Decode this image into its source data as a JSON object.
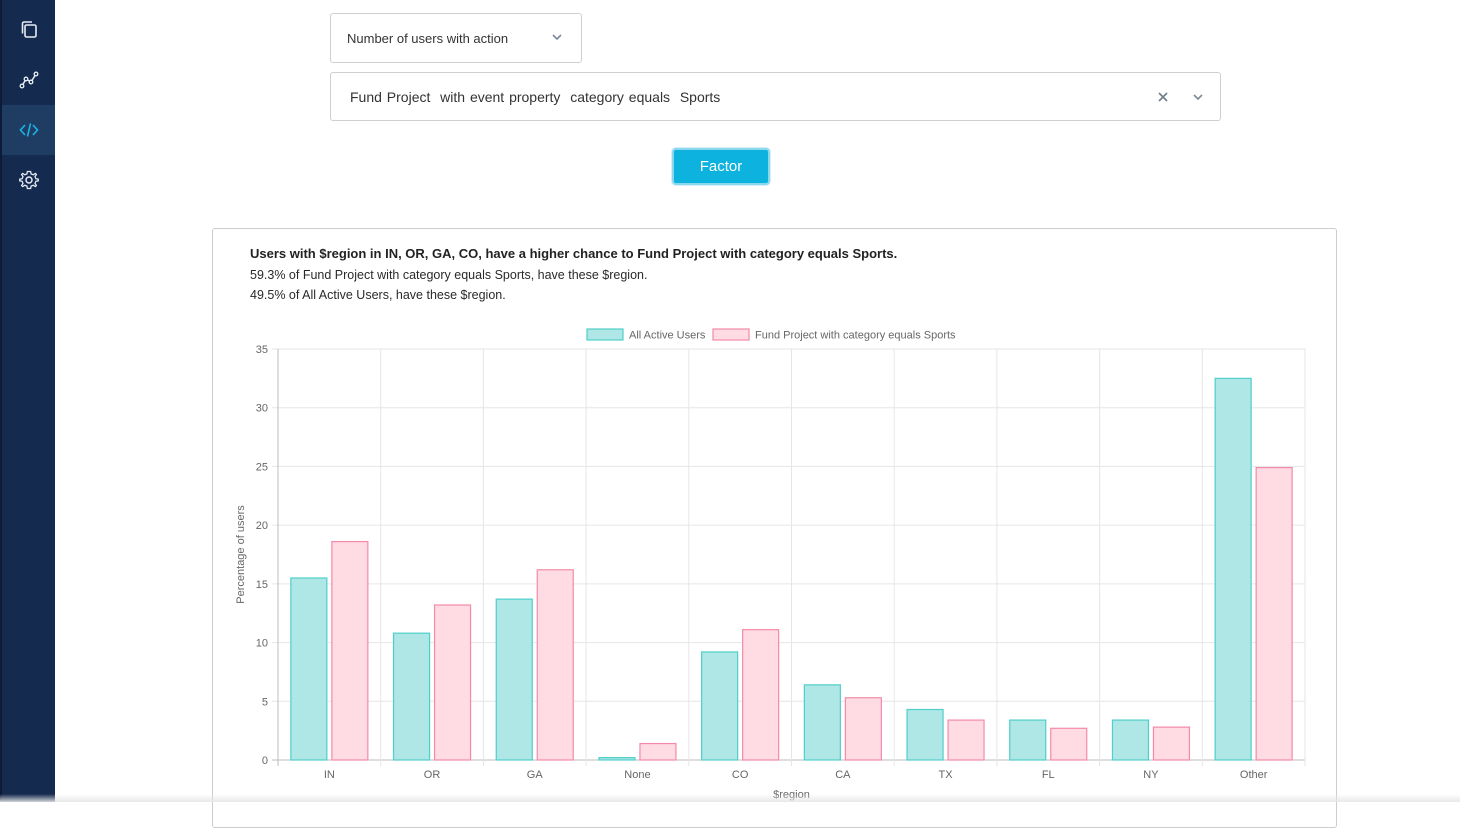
{
  "sidebar": {
    "items": [
      {
        "icon": "copy-icon",
        "active": false
      },
      {
        "icon": "chart-line-icon",
        "active": false
      },
      {
        "icon": "code-icon",
        "active": true
      },
      {
        "icon": "gear-icon",
        "active": false
      }
    ]
  },
  "controls": {
    "metric_select": "Number of users with action",
    "event_filter": "Fund Project  with event property  category equals  Sports",
    "factor_button": "Factor"
  },
  "result": {
    "headline": "Users with $region in IN, OR, GA, CO, have a higher chance to Fund Project with category equals Sports.",
    "line1": "59.3% of Fund Project with category equals Sports, have these $region.",
    "line2": "49.5% of All Active Users, have these $region."
  },
  "colors": {
    "accent": "#0db2df",
    "sidebar": "#142a4e",
    "series1_fill": "#aee7e5",
    "series1_stroke": "#4fcfca",
    "series2_fill": "#ffdbe3",
    "series2_stroke": "#f48aa9"
  },
  "chart_data": {
    "type": "bar",
    "categories": [
      "IN",
      "OR",
      "GA",
      "None",
      "CO",
      "CA",
      "TX",
      "FL",
      "NY",
      "Other"
    ],
    "series": [
      {
        "name": "All Active Users",
        "values": [
          15.5,
          10.8,
          13.7,
          0.2,
          9.2,
          6.4,
          4.3,
          3.4,
          3.4,
          32.5
        ]
      },
      {
        "name": "Fund Project with category equals Sports",
        "values": [
          18.6,
          13.2,
          16.2,
          1.4,
          11.1,
          5.3,
          3.4,
          2.7,
          2.8,
          24.9
        ]
      }
    ],
    "xlabel": "$region",
    "ylabel": "Percentage of users",
    "ylim": [
      0,
      35
    ],
    "yticks": [
      0,
      5,
      10,
      15,
      20,
      25,
      30,
      35
    ],
    "legend": "top",
    "grid": true
  }
}
